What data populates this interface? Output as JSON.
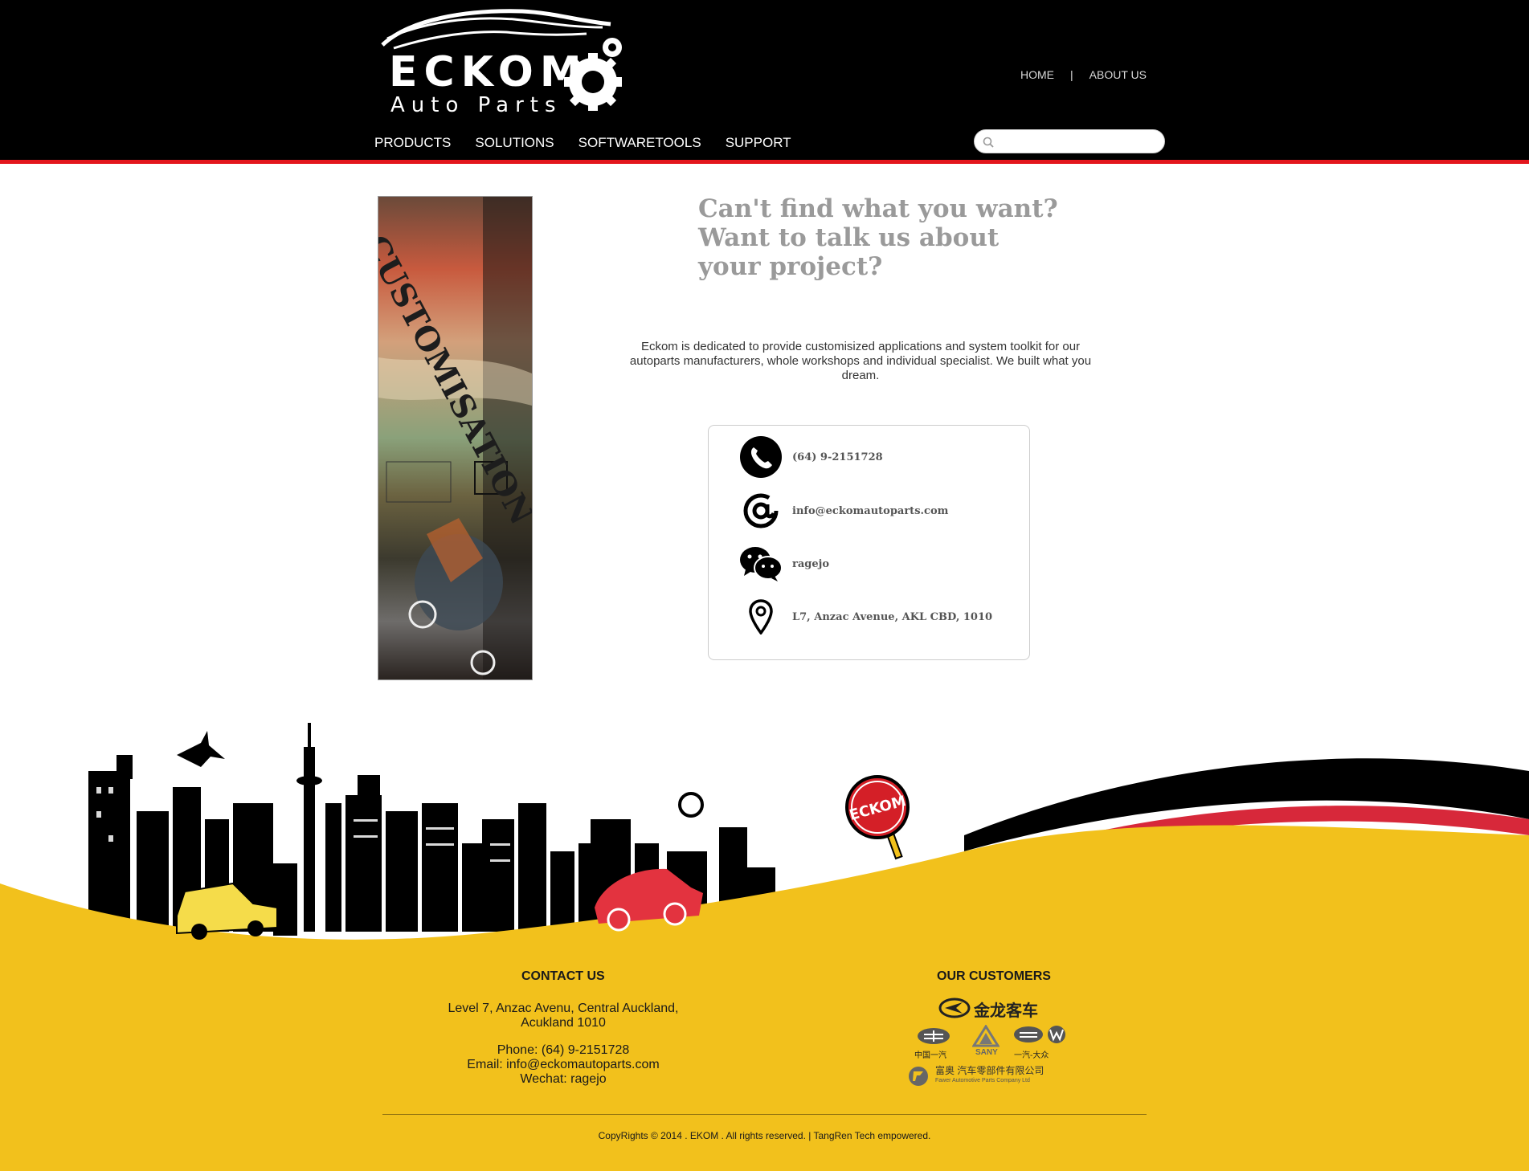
{
  "brand": {
    "logo_name": "ECKOM",
    "logo_tagline": "Auto Parts",
    "colors": {
      "header": "#000000",
      "accent": "#e3161d",
      "footer": "#f2c11c",
      "headline": "#9a9a9a"
    }
  },
  "top_links": {
    "home": "HOME",
    "separator": "|",
    "about": "ABOUT US"
  },
  "nav": {
    "items": [
      {
        "label": "PRODUCTS"
      },
      {
        "label": "SOLUTIONS"
      },
      {
        "label": "SOFTWARETOOLS"
      },
      {
        "label": "SUPPORT"
      }
    ]
  },
  "search": {
    "placeholder": "",
    "value": "",
    "icon": "search-icon"
  },
  "banner": {
    "word": "CUSTOMISATION"
  },
  "main": {
    "headline": "Can't find what you want? Want to talk us about your project?",
    "intro": "Eckom is dedicated to provide customisized applications and system toolkit for our autoparts manufacturers, whole workshops and individual specialist. We built what you dream."
  },
  "contact": {
    "phone": {
      "icon": "phone-icon",
      "text": "(64) 9-2151728"
    },
    "email": {
      "icon": "at-sign-icon",
      "text": "info@eckomautoparts.com"
    },
    "wechat": {
      "icon": "wechat-icon",
      "text": "ragejo"
    },
    "address": {
      "icon": "location-pin-icon",
      "text": "L7, Anzac Avenue, AKL CBD, 1010"
    }
  },
  "scene": {
    "sign_text": "ECKOM"
  },
  "footer": {
    "contact_title": "CONTACT US",
    "address_line1": "Level 7, Anzac Avenu, Central Auckland,",
    "address_line2": "Acukland 1010",
    "phone": "Phone: (64) 9-2151728",
    "email": "Email: info@eckomautoparts.com",
    "wechat": "Wechat: ragejo",
    "customers_title": "OUR CUSTOMERS",
    "customers": {
      "jinlong": "金龙客车",
      "faw": "中国一汽",
      "sany": "SANY",
      "faw_vw": "一汽-大众",
      "fawer_cn": "富奥 汽车零部件有限公司",
      "fawer_en": "Fawer Automotive Parts Company Ltd"
    },
    "copyright": "CopyRights © 2014 . EKOM . All rights reserved. | TangRen Tech empowered."
  }
}
